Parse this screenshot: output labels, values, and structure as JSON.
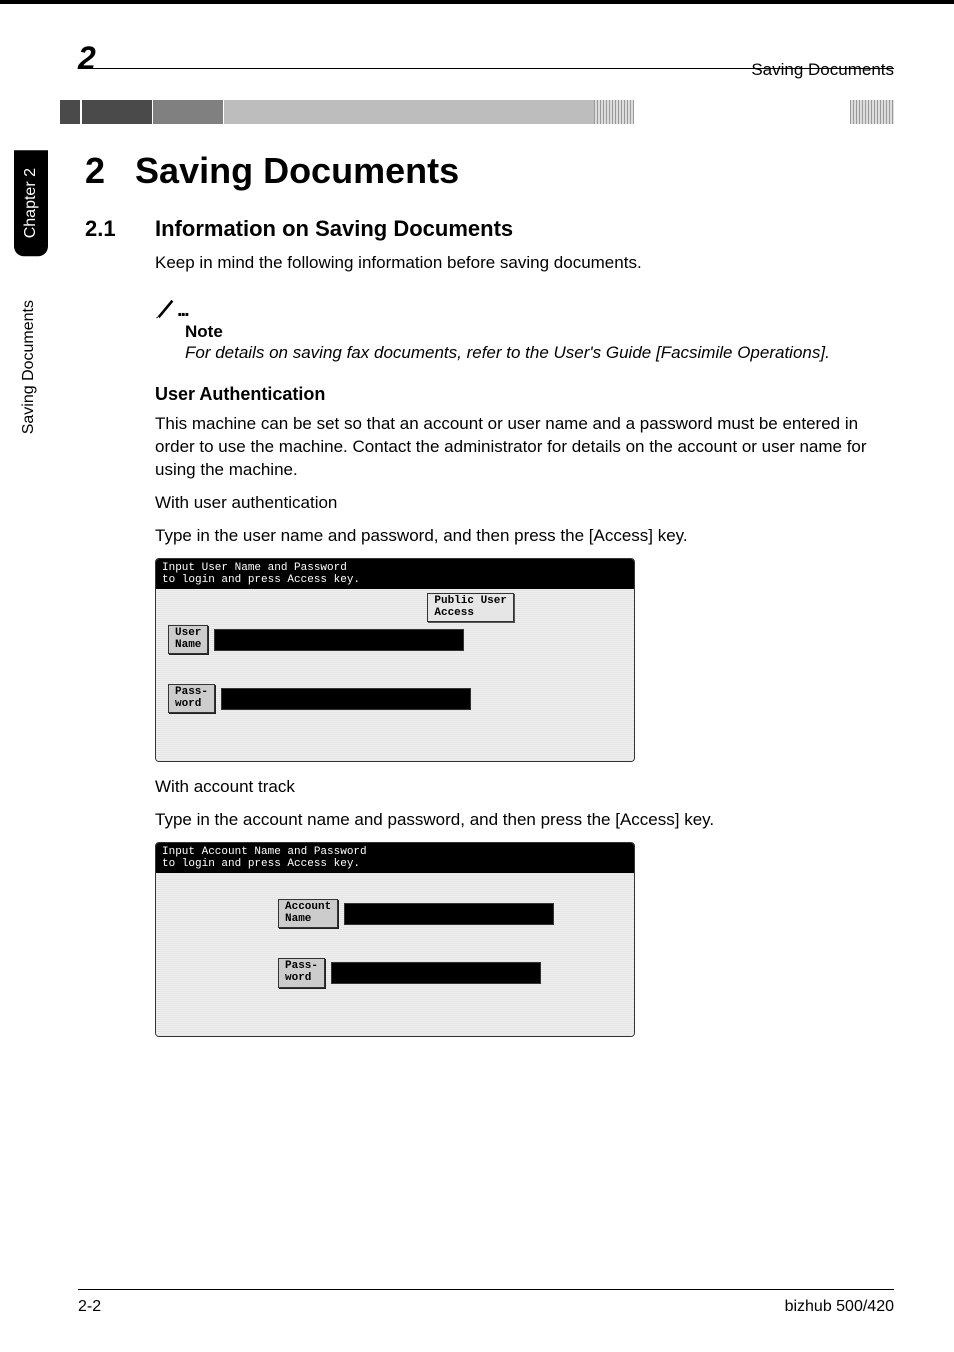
{
  "header": {
    "chapter_indicator": "2",
    "breadcrumb_title": "Saving Documents"
  },
  "side": {
    "tab": "Chapter 2",
    "label": "Saving Documents"
  },
  "chapter": {
    "number": "2",
    "title": "Saving Documents"
  },
  "section": {
    "number": "2.1",
    "title": "Information on Saving Documents",
    "intro": "Keep in mind the following information before saving documents."
  },
  "note": {
    "label": "Note",
    "text": "For details on saving fax documents, refer to the User's Guide [Facsimile Operations]."
  },
  "user_auth": {
    "heading": "User Authentication",
    "body": "This machine can be set so that an account or user name and a password must be entered in order to use the machine. Contact the administrator for details on the account or user name for using the machine.",
    "with_user": "With user authentication",
    "type_user": "Type in the user name and password, and then press the [Access] key.",
    "with_account": "With account track",
    "type_account": "Type in the account name and password, and then press the [Access] key."
  },
  "panel1": {
    "title_line1": "Input User Name and Password",
    "title_line2": "to login and press Access key.",
    "public_user_btn": "Public User\nAccess",
    "user_name_btn": "User\nName",
    "password_btn": "Pass-\nword"
  },
  "panel2": {
    "title_line1": "Input Account Name and Password",
    "title_line2": "to login and press Access key.",
    "account_name_btn": "Account\nName",
    "password_btn": "Pass-\nword"
  },
  "footer": {
    "page": "2-2",
    "model": "bizhub 500/420"
  }
}
